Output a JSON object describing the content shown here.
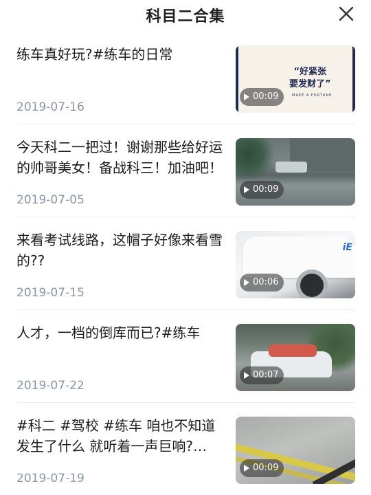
{
  "header": {
    "title": "科目二合集",
    "close_icon": "close-icon"
  },
  "items": [
    {
      "title": "练车真好玩?#练车的日常",
      "date": "2019-07-16",
      "duration": "00:09",
      "thumb_caption": "“好紧张\n要发财了”",
      "thumb_small": "MAKE A FORTUNE"
    },
    {
      "title": "今天科二一把过！谢谢那些给好运的帅哥美女！备战科三！加油吧！",
      "date": "2019-07-05",
      "duration": "00:09"
    },
    {
      "title": "来看考试线路，这帽子好像来看雪的??",
      "date": "2019-07-15",
      "duration": "00:06",
      "thumb_logo": "iЕ"
    },
    {
      "title": "人才，一档的倒库而已?#练车",
      "date": "2019-07-22",
      "duration": "00:07"
    },
    {
      "title": "#科二 #驾校 #练车 咱也不知道发生了什么 就听着一声巨响?…",
      "date": "2019-07-19",
      "duration": "00:09"
    }
  ]
}
